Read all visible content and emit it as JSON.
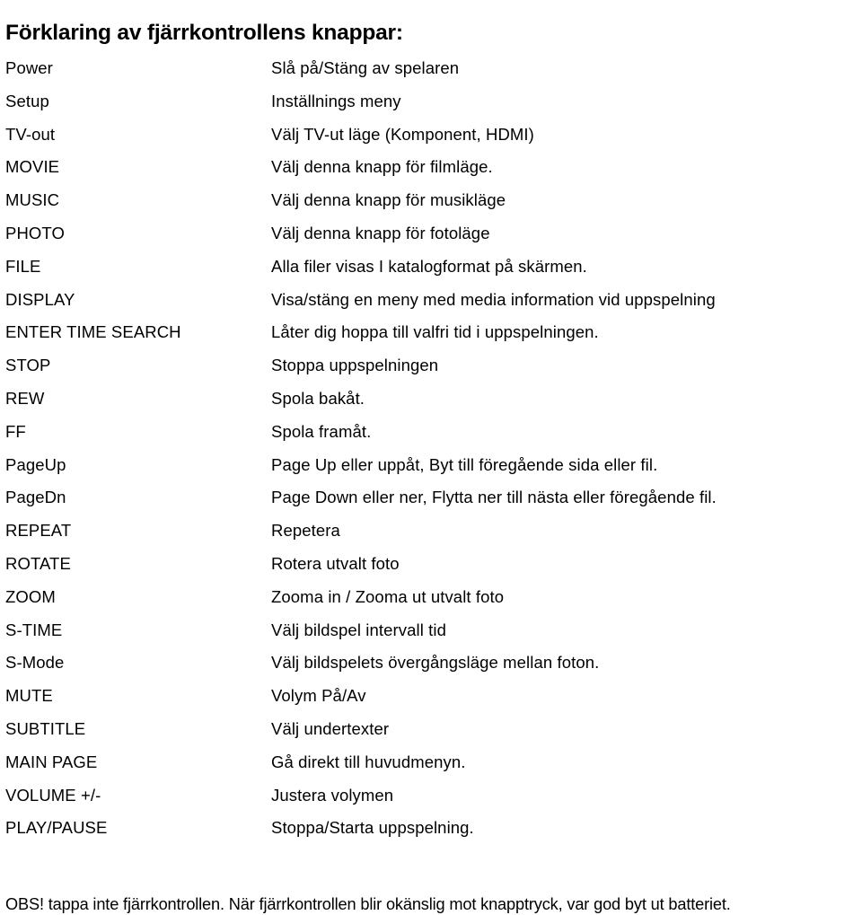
{
  "document": {
    "title": "Förklaring av fjärrkontrollens knappar:",
    "footer_note": "OBS! tappa inte fjärrkontrollen. När fjärrkontrollen blir okänslig mot knapptryck, var god byt ut batteriet."
  },
  "button_table": {
    "rows": [
      {
        "key": "Power",
        "desc": "Slå på/Stäng av spelaren"
      },
      {
        "key": "Setup",
        "desc": "Inställnings meny"
      },
      {
        "key": "TV-out",
        "desc": "Välj TV-ut läge (Komponent, HDMI)"
      },
      {
        "key": "MOVIE",
        "desc": "Välj denna knapp för filmläge."
      },
      {
        "key": "MUSIC",
        "desc": "Välj denna knapp för musikläge"
      },
      {
        "key": "PHOTO",
        "desc": "Välj denna knapp för fotoläge"
      },
      {
        "key": "FILE",
        "desc": "Alla filer visas I katalogformat på skärmen."
      },
      {
        "key": "DISPLAY",
        "desc": "Visa/stäng en meny med media information vid uppspelning"
      },
      {
        "key": "ENTER TIME SEARCH",
        "desc": "Låter dig hoppa till valfri tid i uppspelningen."
      },
      {
        "key": "STOP",
        "desc": "Stoppa uppspelningen"
      },
      {
        "key": "REW",
        "desc": "Spola bakåt."
      },
      {
        "key": "FF",
        "desc": "Spola framåt."
      },
      {
        "key": "PageUp",
        "desc": "Page Up eller uppåt, Byt till föregående sida eller fil."
      },
      {
        "key": "PageDn",
        "desc": "Page Down eller ner, Flytta ner till nästa eller föregående fil."
      },
      {
        "key": "REPEAT",
        "desc": "Repetera"
      },
      {
        "key": "ROTATE",
        "desc": "Rotera utvalt foto"
      },
      {
        "key": "ZOOM",
        "desc": "Zooma in / Zooma ut utvalt foto"
      },
      {
        "key": "S-TIME",
        "desc": "Välj bildspel intervall tid"
      },
      {
        "key": "S-Mode",
        "desc": "Välj bildspelets övergångsläge mellan foton."
      },
      {
        "key": "MUTE",
        "desc": "Volym På/Av"
      },
      {
        "key": "SUBTITLE",
        "desc": "Välj undertexter"
      },
      {
        "key": "MAIN PAGE",
        "desc": "Gå direkt till huvudmenyn."
      },
      {
        "key": "VOLUME +/-",
        "desc": "Justera volymen"
      },
      {
        "key": "PLAY/PAUSE",
        "desc": "Stoppa/Starta uppspelning."
      }
    ]
  }
}
